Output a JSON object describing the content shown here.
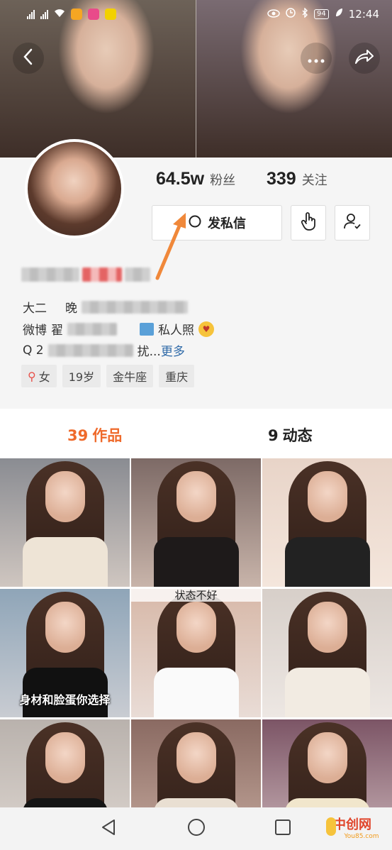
{
  "status_bar": {
    "time": "12:44",
    "signal1": "4G",
    "signal2": "4G",
    "battery": "94"
  },
  "header": {
    "icons": [
      "back-arrow-icon",
      "more-icon",
      "share-icon"
    ]
  },
  "profile": {
    "followers_count": "64.5w",
    "followers_label": "粉丝",
    "following_count": "339",
    "following_label": "关注",
    "message_button": "发私信",
    "bio_line1_prefix": "大二",
    "bio_line1_rest": "晚",
    "bio_line2_prefix": "微博",
    "bio_line2_mid": "翟",
    "bio_line2_suffix": "私人照",
    "bio_line3_prefix": "Q 2",
    "bio_line3_mid": "扰...",
    "bio_more": "更多",
    "tags": [
      {
        "label": "女",
        "icon": "female-icon"
      },
      {
        "label": "19岁"
      },
      {
        "label": "金牛座"
      },
      {
        "label": "重庆"
      }
    ]
  },
  "tabs": [
    {
      "count": "39",
      "label": "作品"
    },
    {
      "count": "9",
      "label": "动态"
    }
  ],
  "grid": {
    "overlay_text": "身材和脸蛋你选择",
    "caption_text": "状态不好"
  },
  "colors": {
    "accent": "#ef6a2b",
    "link": "#2f6aa8",
    "background": "#f5f5f5"
  },
  "watermark": {
    "main": "中创网",
    "sub": "You85.com"
  }
}
